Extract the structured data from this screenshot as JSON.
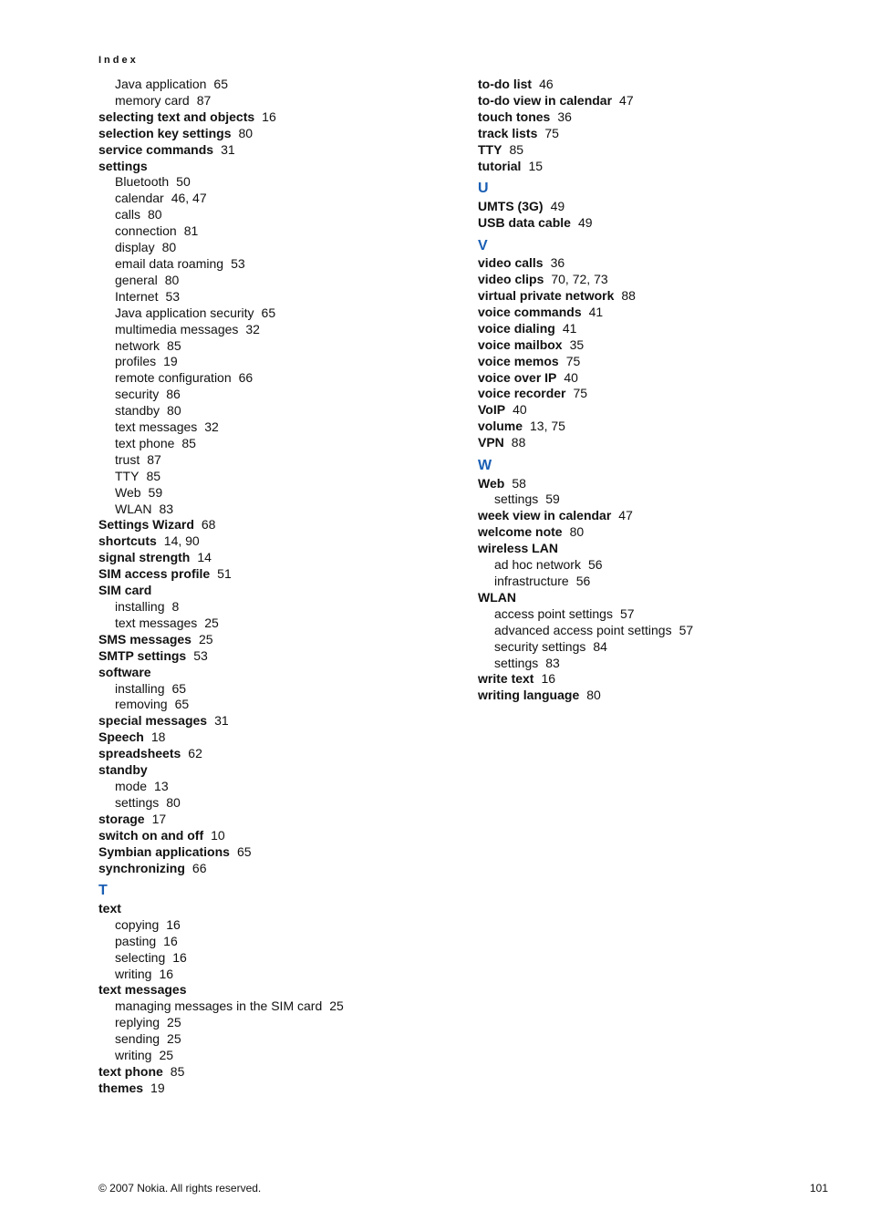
{
  "running_head": "Index",
  "footer": {
    "copyright": "© 2007 Nokia. All rights reserved.",
    "page": "101"
  },
  "left": [
    {
      "type": "sub",
      "term": "Java application",
      "pages": "65"
    },
    {
      "type": "sub",
      "term": "memory card",
      "pages": "87"
    },
    {
      "type": "bold",
      "term": "selecting text and objects",
      "pages": "16"
    },
    {
      "type": "bold",
      "term": "selection key settings",
      "pages": "80"
    },
    {
      "type": "bold",
      "term": "service commands",
      "pages": "31"
    },
    {
      "type": "bold",
      "term": "settings",
      "pages": ""
    },
    {
      "type": "sub",
      "term": "Bluetooth",
      "pages": "50"
    },
    {
      "type": "sub",
      "term": "calendar",
      "pages": "46, 47"
    },
    {
      "type": "sub",
      "term": "calls",
      "pages": "80"
    },
    {
      "type": "sub",
      "term": "connection",
      "pages": "81"
    },
    {
      "type": "sub",
      "term": "display",
      "pages": "80"
    },
    {
      "type": "sub",
      "term": "email data roaming",
      "pages": "53"
    },
    {
      "type": "sub",
      "term": "general",
      "pages": "80"
    },
    {
      "type": "sub",
      "term": "Internet",
      "pages": "53"
    },
    {
      "type": "sub",
      "term": "Java application security",
      "pages": "65"
    },
    {
      "type": "sub",
      "term": "multimedia messages",
      "pages": "32"
    },
    {
      "type": "sub",
      "term": "network",
      "pages": "85"
    },
    {
      "type": "sub",
      "term": "profiles",
      "pages": "19"
    },
    {
      "type": "sub",
      "term": "remote configuration",
      "pages": "66"
    },
    {
      "type": "sub",
      "term": "security",
      "pages": "86"
    },
    {
      "type": "sub",
      "term": "standby",
      "pages": "80"
    },
    {
      "type": "sub",
      "term": "text messages",
      "pages": "32"
    },
    {
      "type": "sub",
      "term": "text phone",
      "pages": "85"
    },
    {
      "type": "sub",
      "term": "trust",
      "pages": "87"
    },
    {
      "type": "sub",
      "term": "TTY",
      "pages": "85"
    },
    {
      "type": "sub",
      "term": "Web",
      "pages": "59"
    },
    {
      "type": "sub",
      "term": "WLAN",
      "pages": "83"
    },
    {
      "type": "bold",
      "term": "Settings Wizard",
      "pages": "68"
    },
    {
      "type": "bold",
      "term": "shortcuts",
      "pages": "14, 90"
    },
    {
      "type": "bold",
      "term": "signal strength",
      "pages": "14"
    },
    {
      "type": "bold",
      "term": "SIM access profile",
      "pages": "51"
    },
    {
      "type": "bold",
      "term": "SIM card",
      "pages": ""
    },
    {
      "type": "sub",
      "term": "installing",
      "pages": "8"
    },
    {
      "type": "sub",
      "term": "text messages",
      "pages": "25"
    },
    {
      "type": "bold",
      "term": "SMS messages",
      "pages": "25"
    },
    {
      "type": "bold",
      "term": "SMTP settings",
      "pages": "53"
    },
    {
      "type": "bold",
      "term": "software",
      "pages": ""
    },
    {
      "type": "sub",
      "term": "installing",
      "pages": "65"
    },
    {
      "type": "sub",
      "term": "removing",
      "pages": "65"
    },
    {
      "type": "bold",
      "term": "special messages",
      "pages": "31"
    },
    {
      "type": "bold",
      "term": "Speech",
      "pages": "18"
    },
    {
      "type": "bold",
      "term": "spreadsheets",
      "pages": "62"
    },
    {
      "type": "bold",
      "term": "standby",
      "pages": ""
    },
    {
      "type": "sub",
      "term": "mode",
      "pages": "13"
    },
    {
      "type": "sub",
      "term": "settings",
      "pages": "80"
    },
    {
      "type": "bold",
      "term": "storage",
      "pages": "17"
    },
    {
      "type": "bold",
      "term": "switch on and off",
      "pages": "10"
    },
    {
      "type": "bold",
      "term": "Symbian applications",
      "pages": "65"
    },
    {
      "type": "bold",
      "term": "synchronizing",
      "pages": "66"
    },
    {
      "type": "head",
      "term": "T"
    },
    {
      "type": "bold",
      "term": "text",
      "pages": ""
    },
    {
      "type": "sub",
      "term": "copying",
      "pages": "16"
    },
    {
      "type": "sub",
      "term": "pasting",
      "pages": "16"
    },
    {
      "type": "sub",
      "term": "selecting",
      "pages": "16"
    },
    {
      "type": "sub",
      "term": "writing",
      "pages": "16"
    },
    {
      "type": "bold",
      "term": "text messages",
      "pages": ""
    },
    {
      "type": "sub",
      "term": "managing messages in the SIM card",
      "pages": "25"
    },
    {
      "type": "sub",
      "term": "replying",
      "pages": "25"
    },
    {
      "type": "sub",
      "term": "sending",
      "pages": "25"
    },
    {
      "type": "sub",
      "term": "writing",
      "pages": "25"
    },
    {
      "type": "bold",
      "term": "text phone",
      "pages": "85"
    },
    {
      "type": "bold",
      "term": "themes",
      "pages": "19"
    }
  ],
  "right": [
    {
      "type": "bold",
      "term": "to-do list",
      "pages": "46"
    },
    {
      "type": "bold",
      "term": "to-do view in calendar",
      "pages": "47"
    },
    {
      "type": "bold",
      "term": "touch tones",
      "pages": "36"
    },
    {
      "type": "bold",
      "term": "track lists",
      "pages": "75"
    },
    {
      "type": "bold",
      "term": "TTY",
      "pages": "85"
    },
    {
      "type": "bold",
      "term": "tutorial",
      "pages": "15"
    },
    {
      "type": "head",
      "term": "U"
    },
    {
      "type": "bold",
      "term": "UMTS (3G)",
      "pages": "49"
    },
    {
      "type": "bold",
      "term": "USB data cable",
      "pages": "49"
    },
    {
      "type": "head",
      "term": "V"
    },
    {
      "type": "bold",
      "term": "video calls",
      "pages": "36"
    },
    {
      "type": "bold",
      "term": "video clips",
      "pages": "70, 72, 73"
    },
    {
      "type": "bold",
      "term": "virtual private network",
      "pages": "88"
    },
    {
      "type": "bold",
      "term": "voice commands",
      "pages": "41"
    },
    {
      "type": "bold",
      "term": "voice dialing",
      "pages": "41"
    },
    {
      "type": "bold",
      "term": "voice mailbox",
      "pages": "35"
    },
    {
      "type": "bold",
      "term": "voice memos",
      "pages": "75"
    },
    {
      "type": "bold",
      "term": "voice over IP",
      "pages": "40"
    },
    {
      "type": "bold",
      "term": "voice recorder",
      "pages": "75"
    },
    {
      "type": "bold",
      "term": "VoIP",
      "pages": "40"
    },
    {
      "type": "bold",
      "term": "volume",
      "pages": "13, 75"
    },
    {
      "type": "bold",
      "term": "VPN",
      "pages": "88"
    },
    {
      "type": "head",
      "term": "W"
    },
    {
      "type": "bold",
      "term": "Web",
      "pages": "58"
    },
    {
      "type": "sub",
      "term": "settings",
      "pages": "59"
    },
    {
      "type": "bold",
      "term": "week view in calendar",
      "pages": "47"
    },
    {
      "type": "bold",
      "term": "welcome note",
      "pages": "80"
    },
    {
      "type": "bold",
      "term": "wireless LAN",
      "pages": ""
    },
    {
      "type": "sub",
      "term": "ad hoc network",
      "pages": "56"
    },
    {
      "type": "sub",
      "term": "infrastructure",
      "pages": "56"
    },
    {
      "type": "bold",
      "term": "WLAN",
      "pages": ""
    },
    {
      "type": "sub",
      "term": "access point settings",
      "pages": "57"
    },
    {
      "type": "sub",
      "term": "advanced access point settings",
      "pages": "57"
    },
    {
      "type": "sub",
      "term": "security settings",
      "pages": "84"
    },
    {
      "type": "sub",
      "term": "settings",
      "pages": "83"
    },
    {
      "type": "bold",
      "term": "write text",
      "pages": "16"
    },
    {
      "type": "bold",
      "term": "writing language",
      "pages": "80"
    }
  ]
}
